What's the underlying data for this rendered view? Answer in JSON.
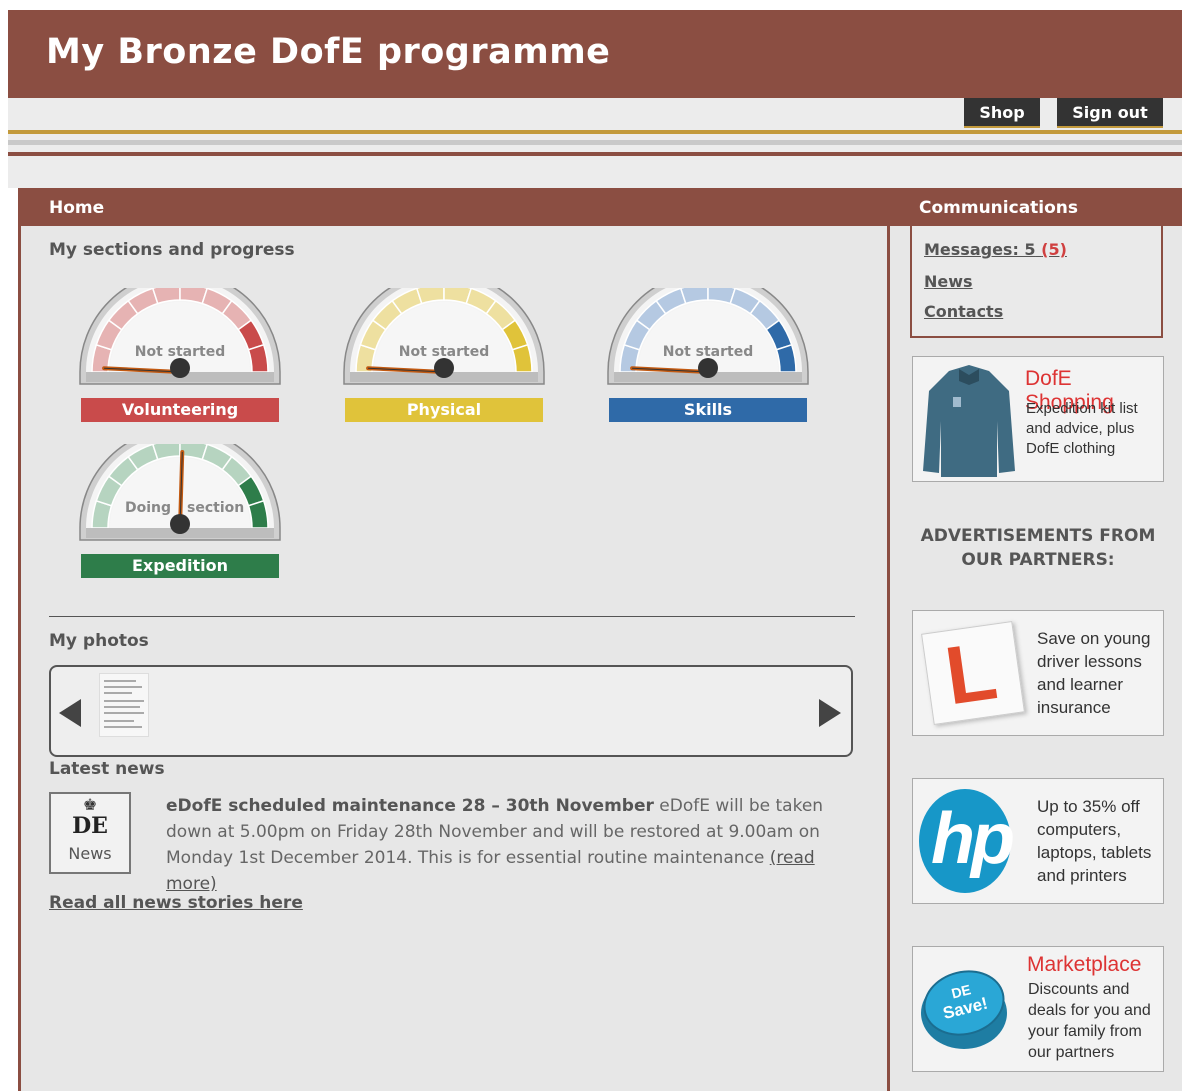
{
  "app": {
    "title": "My Bronze DofE programme"
  },
  "topnav": {
    "shop": "Shop",
    "signout": "Sign out"
  },
  "main": {
    "heading": "Home",
    "sections_title": "My sections and progress",
    "gauges": [
      {
        "name": "Volunteering",
        "status": "Not started",
        "color": "#c94b4b",
        "light": "#e6b3b3"
      },
      {
        "name": "Physical",
        "status": "Not started",
        "color": "#e0c33a",
        "light": "#eee0a0"
      },
      {
        "name": "Skills",
        "status": "Not started",
        "color": "#2f6aa8",
        "light": "#b5c9e2"
      },
      {
        "name": "Expedition",
        "status_left": "Doing",
        "status_right": "section",
        "color": "#2e7d4a",
        "light": "#b6d4c0"
      }
    ],
    "photos_title": "My photos",
    "latest_news_title": "Latest news",
    "news_icon": {
      "crown": "♚",
      "logo": "DE",
      "label": "News"
    },
    "news": {
      "headline": "eDofE scheduled maintenance 28 – 30th November",
      "body": " eDofE will be taken down at 5.00pm on Friday 28th November and will be restored at 9.00am on Monday 1st December 2014. This is for essential routine maintenance ",
      "read_more": "(read more)"
    },
    "read_all": "Read all news stories here"
  },
  "sidebar": {
    "heading": "Communications",
    "messages_label": "Messages: 5",
    "messages_count": "(5)",
    "news_link": "News",
    "contacts_link": "Contacts",
    "shopping_ad": {
      "title": "DofE Shopping",
      "desc": "Expedition kit list and advice, plus DofE clothing"
    },
    "ads_heading": "ADVERTISEMENTS FROM OUR PARTNERS:",
    "driver_ad": {
      "desc": "Save on young driver lessons and learner insurance",
      "logo": "L"
    },
    "hp_ad": {
      "desc": "Up to 35% off computers, laptops, tablets and printers",
      "logo": "hp"
    },
    "market_ad": {
      "title": "Marketplace",
      "desc": "Discounts and deals for you and your family from our partners",
      "badge_top": "DE",
      "badge_bottom": "Save!"
    }
  }
}
